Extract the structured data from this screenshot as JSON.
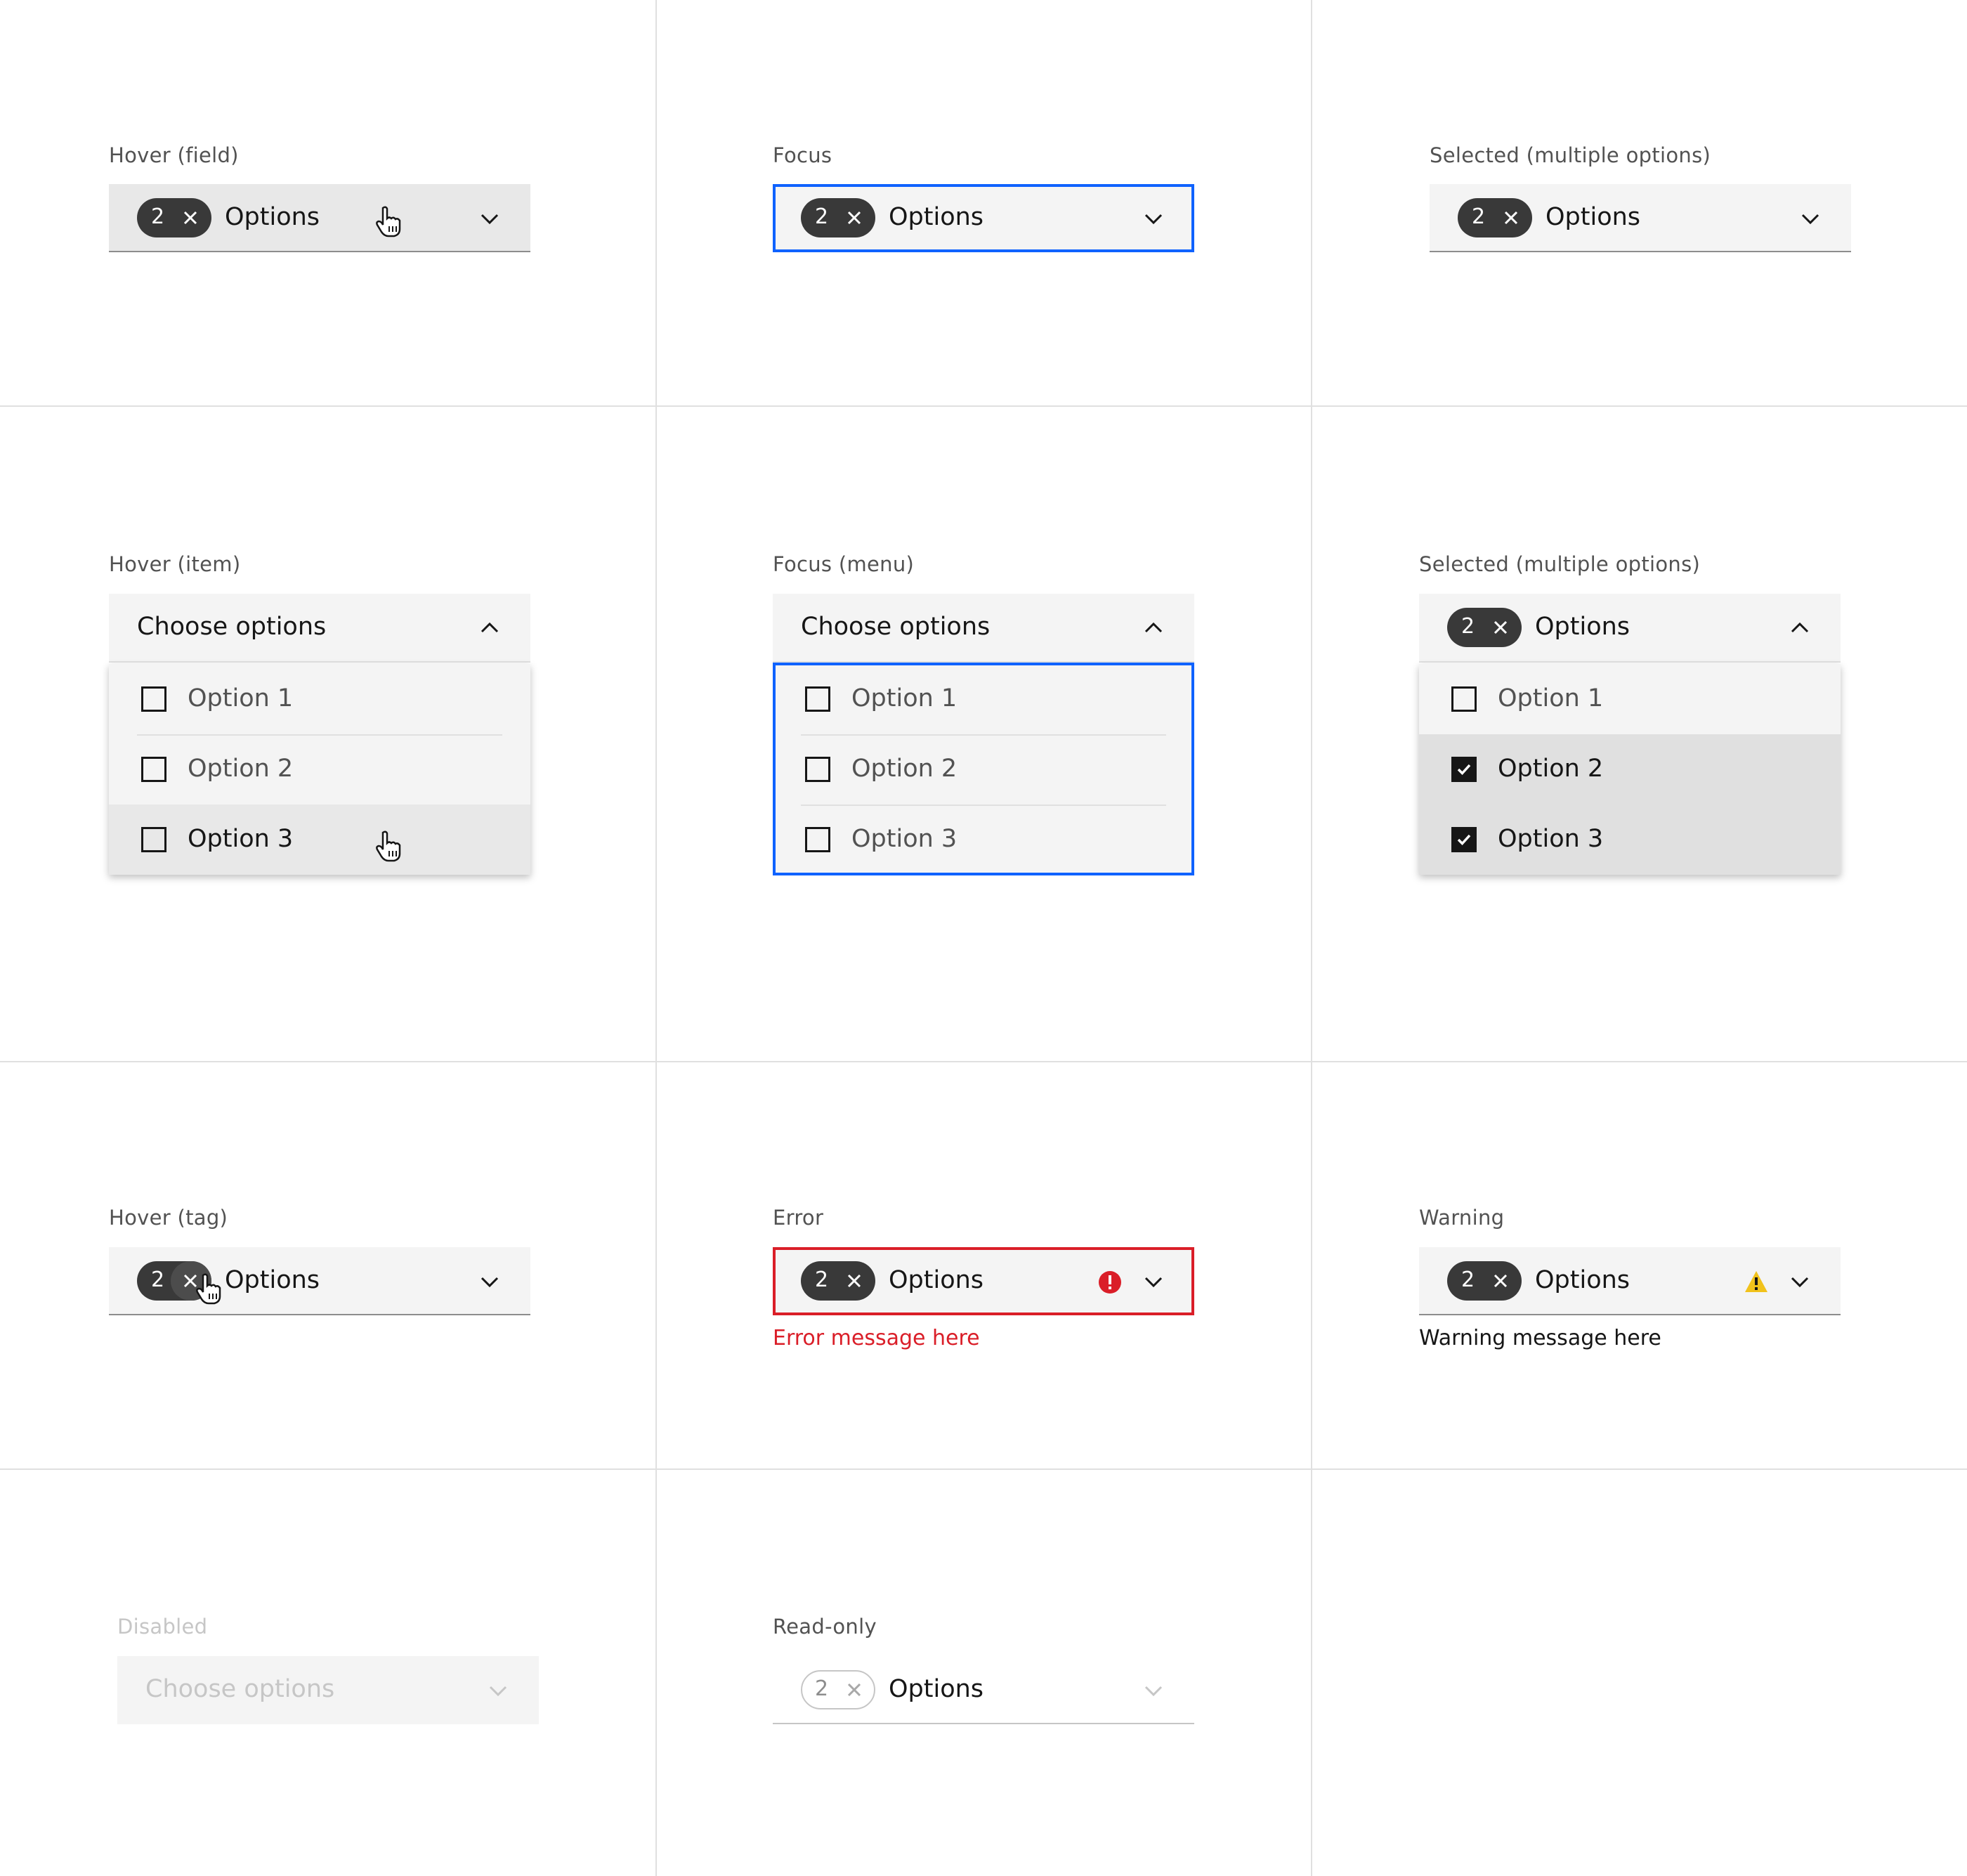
{
  "colors": {
    "focus": "#0f62fe",
    "error": "#da1e28",
    "warning": "#f1c21b",
    "tag": "#393939",
    "field": "#f4f4f4"
  },
  "states": {
    "hover_field": {
      "label": "Hover (field)",
      "tag_count": "2",
      "value": "Options"
    },
    "focus": {
      "label": "Focus",
      "tag_count": "2",
      "value": "Options"
    },
    "selected_closed": {
      "label": "Selected (multiple options)",
      "tag_count": "2",
      "value": "Options"
    },
    "hover_item": {
      "label": "Hover (item)",
      "placeholder": "Choose options",
      "items": [
        "Option 1",
        "Option 2",
        "Option 3"
      ],
      "hovered_item": "Option 3"
    },
    "focus_menu": {
      "label": "Focus (menu)",
      "placeholder": "Choose options",
      "items": [
        "Option 1",
        "Option 2",
        "Option 3"
      ]
    },
    "selected_open": {
      "label": "Selected (multiple options)",
      "tag_count": "2",
      "value": "Options",
      "items": [
        "Option 1",
        "Option 2",
        "Option 3"
      ],
      "checked": [
        "Option 2",
        "Option 3"
      ]
    },
    "hover_tag": {
      "label": "Hover (tag)",
      "tag_count": "2",
      "value": "Options"
    },
    "error": {
      "label": "Error",
      "tag_count": "2",
      "value": "Options",
      "message": "Error message here",
      "icon": "error-icon"
    },
    "warning": {
      "label": "Warning",
      "tag_count": "2",
      "value": "Options",
      "message": "Warning message here",
      "icon": "warning-icon"
    },
    "disabled": {
      "label": "Disabled",
      "placeholder": "Choose options"
    },
    "readonly": {
      "label": "Read-only",
      "tag_count": "2",
      "value": "Options"
    }
  }
}
